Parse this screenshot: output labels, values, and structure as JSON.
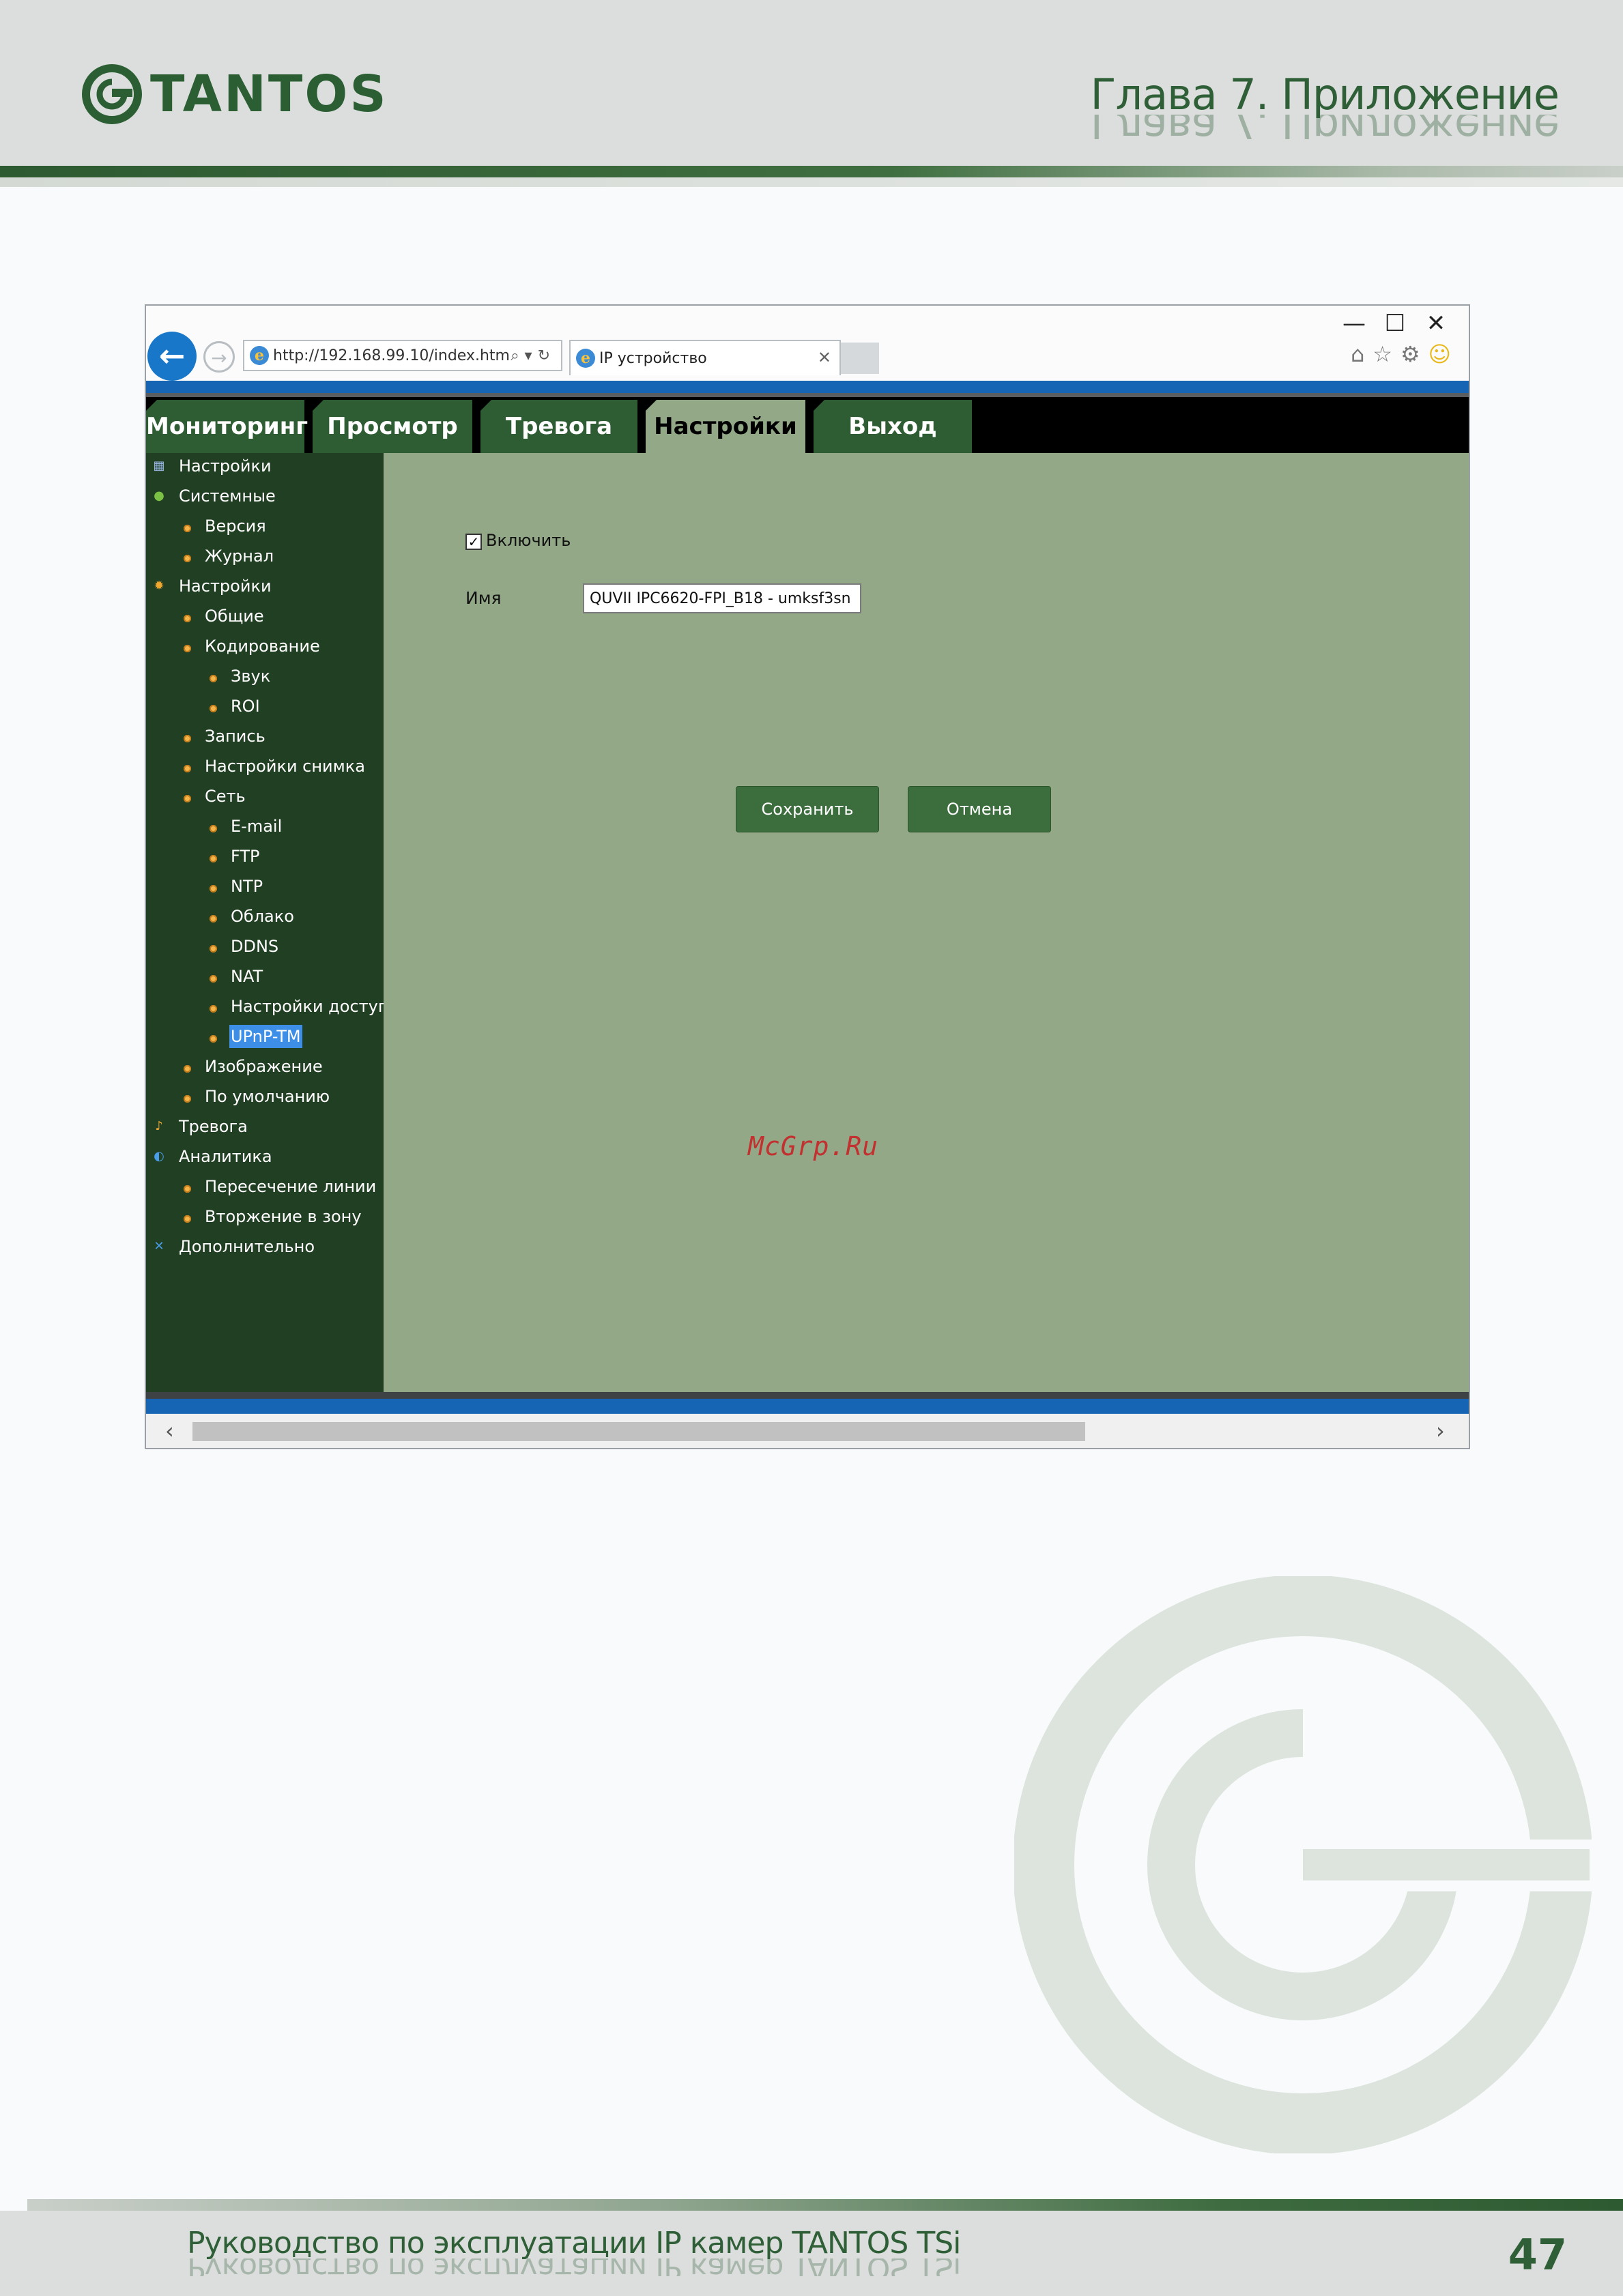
{
  "header": {
    "logo_text": "TANTOS",
    "chapter_title": "Глава 7. Приложение"
  },
  "browser": {
    "address": "http://192.168.99.10/index.htm",
    "tab_title": "IP устройство",
    "window_controls": [
      "minimize-icon",
      "maximize-icon",
      "close-icon"
    ],
    "toolbar_icons": [
      "home-icon",
      "star-icon",
      "gear-icon",
      "smiley-icon"
    ]
  },
  "menu": {
    "tabs": [
      {
        "label": "Мониторинг",
        "active": false
      },
      {
        "label": "Просмотр",
        "active": false
      },
      {
        "label": "Тревога",
        "active": false
      },
      {
        "label": "Настройки",
        "active": true
      },
      {
        "label": "Выход",
        "active": false
      }
    ]
  },
  "sidebar": {
    "items": [
      {
        "label": "Настройки",
        "level": 0,
        "icon": "settings-icon"
      },
      {
        "label": "Системные",
        "level": 0,
        "icon": "info-icon"
      },
      {
        "label": "Версия",
        "level": 1
      },
      {
        "label": "Журнал",
        "level": 1
      },
      {
        "label": "Настройки",
        "level": 0,
        "icon": "gear-icon"
      },
      {
        "label": "Общие",
        "level": 1
      },
      {
        "label": "Кодирование",
        "level": 1
      },
      {
        "label": "Звук",
        "level": 2
      },
      {
        "label": "ROI",
        "level": 2
      },
      {
        "label": "Запись",
        "level": 1
      },
      {
        "label": "Настройки снимка",
        "level": 1
      },
      {
        "label": "Сеть",
        "level": 1
      },
      {
        "label": "E-mail",
        "level": 2
      },
      {
        "label": "FTP",
        "level": 2
      },
      {
        "label": "NTP",
        "level": 2
      },
      {
        "label": "Облако",
        "level": 2
      },
      {
        "label": "DDNS",
        "level": 2
      },
      {
        "label": "NAT",
        "level": 2
      },
      {
        "label": "Настройки доступа",
        "level": 2
      },
      {
        "label": "UPnP-TM",
        "level": 2,
        "selected": true
      },
      {
        "label": "Изображение",
        "level": 1
      },
      {
        "label": "По умолчанию",
        "level": 1
      },
      {
        "label": "Тревога",
        "level": 0,
        "icon": "bell-icon"
      },
      {
        "label": "Аналитика",
        "level": 0,
        "icon": "analytics-icon"
      },
      {
        "label": "Пересечение линии",
        "level": 1
      },
      {
        "label": "Вторжение в зону",
        "level": 1
      },
      {
        "label": "Дополнительно",
        "level": 0,
        "icon": "tools-icon"
      }
    ]
  },
  "form": {
    "enable_label": "Включить",
    "enable_checked": true,
    "name_label": "Имя",
    "name_value": "QUVII IPC6620-FPI_B18 - umksf3sn",
    "save_label": "Сохранить",
    "cancel_label": "Отмена"
  },
  "watermark_text": "McGrp.Ru",
  "footer": {
    "title": "Руководство по эксплуатации IP камер TANTOS TSi",
    "page_number": "47"
  },
  "colors": {
    "brand_green": "#2e5f36",
    "sidebar_bg": "#213f22",
    "content_bg": "#92a887",
    "menu_tab": "#2f5d33",
    "button": "#3b6e3c",
    "selection": "#3d8ee6"
  }
}
